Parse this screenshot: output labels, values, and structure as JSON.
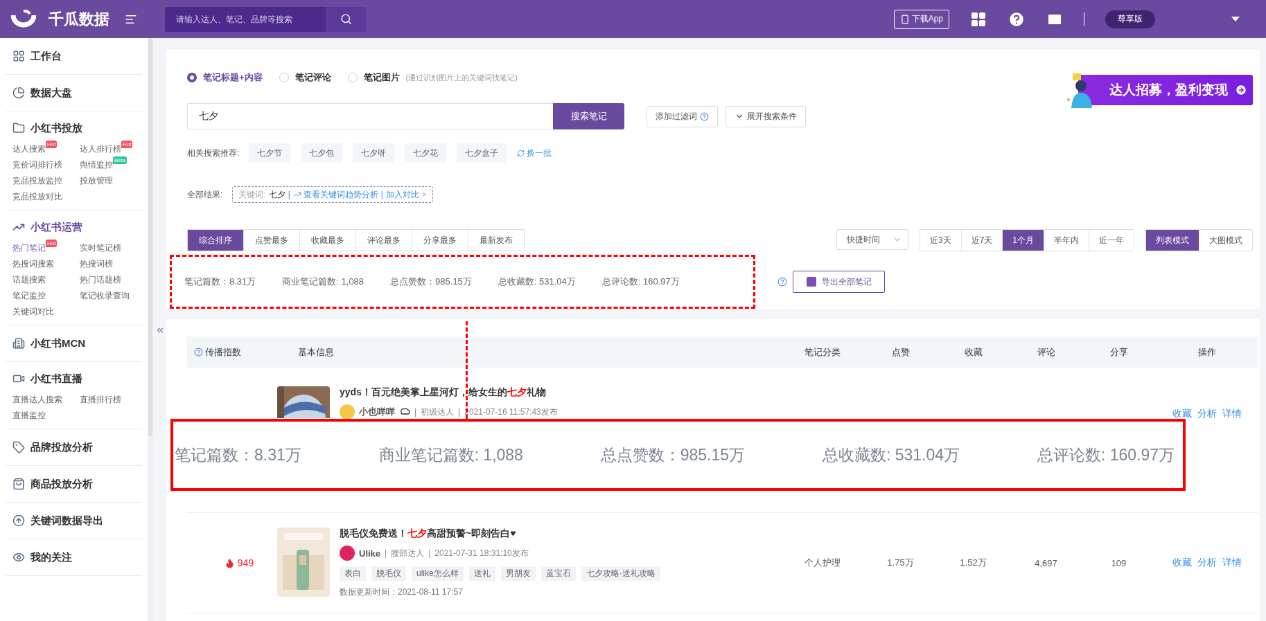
{
  "header": {
    "logo_text": "千瓜数据",
    "search": {
      "placeholder": "请输入达人、笔记、品牌等搜索"
    },
    "download_label": "下载App",
    "plan_label": "尊享版"
  },
  "sidebar": {
    "sections": [
      {
        "label": "工作台",
        "selected": false
      },
      {
        "label": "数据大盘",
        "selected": false
      },
      {
        "label": "小红书投放",
        "selected": false,
        "items": [
          {
            "label": "达人搜索",
            "selected": false,
            "badge": {
              "text": "Hot",
              "color": "#f5515f"
            }
          },
          {
            "label": "达人排行榜",
            "selected": false,
            "badge": {
              "text": "Hot",
              "color": "#f5515f"
            }
          },
          {
            "label": "竞价词排行榜",
            "selected": false
          },
          {
            "label": "舆情监控",
            "selected": false,
            "badge": {
              "text": "Beta",
              "color": "#2fc59a"
            }
          },
          {
            "label": "竞品投放监控",
            "selected": false
          },
          {
            "label": "投放管理",
            "selected": false
          },
          {
            "label": "竞品投放对比",
            "selected": false
          }
        ]
      },
      {
        "label": "小红书运营",
        "selected": true,
        "items": [
          {
            "label": "热门笔记",
            "selected": true,
            "badge": {
              "text": "Hot",
              "color": "#f5515f"
            }
          },
          {
            "label": "实时笔记榜",
            "selected": false
          },
          {
            "label": "热搜词搜索",
            "selected": false
          },
          {
            "label": "热搜词榜",
            "selected": false
          },
          {
            "label": "话题搜索",
            "selected": false
          },
          {
            "label": "热门话题榜",
            "selected": false
          },
          {
            "label": "笔记监控",
            "selected": false
          },
          {
            "label": "笔记收录查询",
            "selected": false
          },
          {
            "label": "关键词对比",
            "selected": false
          }
        ]
      },
      {
        "label": "小红书MCN",
        "selected": false
      },
      {
        "label": "小红书直播",
        "selected": false,
        "items": [
          {
            "label": "直播达人搜索",
            "selected": false
          },
          {
            "label": "直播排行榜",
            "selected": false
          },
          {
            "label": "直播监控",
            "selected": false
          }
        ]
      },
      {
        "label": "品牌投放分析",
        "selected": false
      },
      {
        "label": "商品投放分析",
        "selected": false
      },
      {
        "label": "关键词数据导出",
        "selected": false
      },
      {
        "label": "我的关注",
        "selected": false
      }
    ]
  },
  "search_types": [
    {
      "label": "笔记标题+内容",
      "selected": true
    },
    {
      "label": "笔记评论",
      "selected": false
    },
    {
      "label": "笔记图片",
      "selected": false,
      "hint": "(通过识别图片上的关键词找笔记)"
    }
  ],
  "search": {
    "value": "七夕",
    "button": "搜索笔记",
    "filter_button": "添加过滤词",
    "expand_button": "展开搜索条件"
  },
  "banner": {
    "text": "达人招募，盈利变现"
  },
  "related": {
    "label": "相关搜索推荐:",
    "items": [
      "七夕节",
      "七夕包",
      "七夕呀",
      "七夕花",
      "七夕盒子"
    ],
    "refresh": "换一批"
  },
  "result": {
    "label": "全部结果:",
    "keyword_label": "关键词:",
    "keyword": "七夕",
    "separators": [
      "|",
      "|"
    ],
    "trend_link": "查看关键词趋势分析",
    "compare_link": "加入对比",
    "close": "×"
  },
  "sort_tabs": [
    {
      "label": "综合排序",
      "selected": true
    },
    {
      "label": "点赞最多",
      "selected": false
    },
    {
      "label": "收藏最多",
      "selected": false
    },
    {
      "label": "评论最多",
      "selected": false
    },
    {
      "label": "分享最多",
      "selected": false
    },
    {
      "label": "最新发布",
      "selected": false
    }
  ],
  "time_select": {
    "placeholder": "快捷时间"
  },
  "time_tabs": [
    {
      "label": "近3天",
      "selected": false
    },
    {
      "label": "近7天",
      "selected": false
    },
    {
      "label": "1个月",
      "selected": true
    },
    {
      "label": "半年内",
      "selected": false
    },
    {
      "label": "近一年",
      "selected": false
    }
  ],
  "view_tabs": [
    {
      "label": "列表模式",
      "selected": true
    },
    {
      "label": "大图模式",
      "selected": false
    }
  ],
  "stats": [
    "笔记篇数：8.31万",
    "商业笔记篇数: 1,088",
    "总点赞数：985.15万",
    "总收藏数: 531.04万",
    "总评论数: 160.97万"
  ],
  "export_button": "导出全部笔记",
  "table": {
    "columns": [
      "传播指数",
      "基本信息",
      "笔记分类",
      "点赞",
      "收藏",
      "评论",
      "分享",
      "操作"
    ],
    "rows": [
      {
        "title_before": "yyds！百元绝美掌上星河灯，给女生的",
        "title_highlight": "七夕",
        "title_after": "礼物",
        "author": "小也咩咩",
        "separators": [
          "|",
          "|"
        ],
        "level": "初级达人",
        "published": "2021-07-16 11:57:43发布",
        "actions": [
          "收藏",
          "分析",
          "详情"
        ]
      },
      {
        "index": "949",
        "title_before": "脱毛仪免费送！",
        "title_highlight": "七夕",
        "title_after": "高甜预警~即刻告白♥",
        "author": "Ulike",
        "separators": [
          "|",
          "|"
        ],
        "level": "腰部达人",
        "published": "2021-07-31 18:31:10发布",
        "tags": [
          "表白",
          "脱毛仪",
          "ulike怎么样",
          "送礼",
          "男朋友",
          "蓝宝石",
          "七夕攻略·送礼攻略"
        ],
        "updated": "数据更新时间：2021-08-11 17:57",
        "category": "个人护理",
        "likes": "1.75万",
        "favorites": "1.52万",
        "comments": "4,697",
        "shares": "109",
        "actions": [
          "收藏",
          "分析",
          "详情"
        ]
      }
    ]
  },
  "callout": {
    "stats": [
      "笔记篇数：8.31万",
      "商业笔记篇数: 1,088",
      "总点赞数：985.15万",
      "总收藏数: 531.04万",
      "总评论数: 160.97万"
    ]
  }
}
